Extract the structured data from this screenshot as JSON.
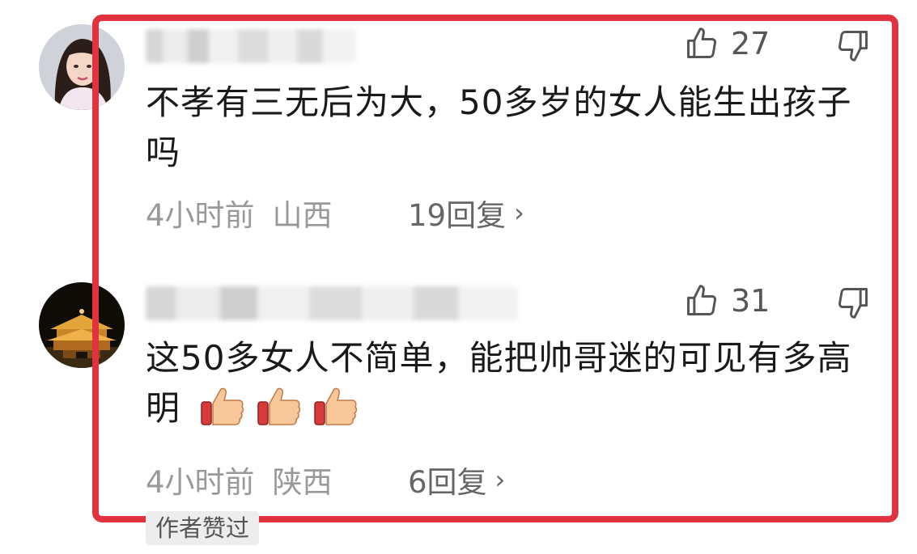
{
  "comments": [
    {
      "likes": "27",
      "text": "不孝有三无后为大，50多岁的女人能生出孩子吗",
      "time": "4小时前",
      "location": "山西",
      "replies": "19回复"
    },
    {
      "likes": "31",
      "text": "这50多女人不简单，能把帅哥迷的可见有多高明",
      "time": "4小时前",
      "location": "陕西",
      "replies": "6回复"
    }
  ],
  "author_badge": "作者赞过",
  "icons": {
    "like": "thumbs-up-outline-icon",
    "dislike": "thumbs-down-outline-icon",
    "reply_arrow": "chevron-right-icon",
    "emoji": "thumbs-up-emoji-icon"
  },
  "colors": {
    "highlight": "#e1323f",
    "meta": "#999999"
  }
}
